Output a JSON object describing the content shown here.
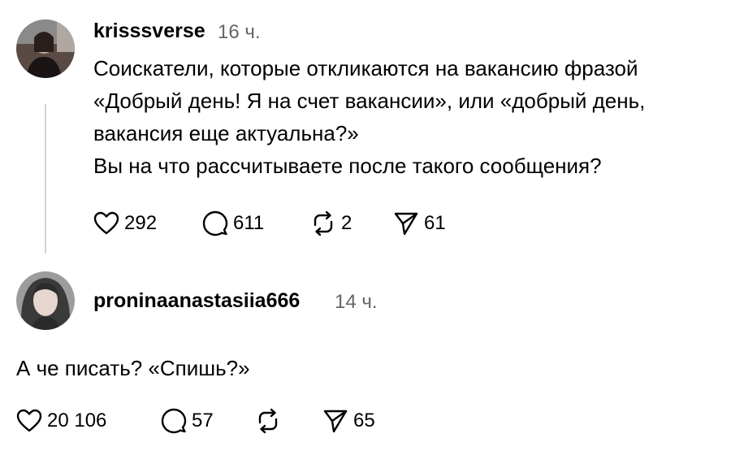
{
  "post": {
    "username": "krisssverse",
    "time": "16 ч.",
    "lines": [
      "Соискатели, которые откликаются на вакансию фразой",
      "«Добрый день! Я на счет вакансии», или «добрый день,",
      "вакансия еще актуальна?»",
      "Вы на что рассчитываете после такого сообщения?"
    ],
    "likes": "292",
    "comments": "611",
    "reposts": "2",
    "shares": "61"
  },
  "reply": {
    "username": "proninaanastasiia666",
    "time": "14 ч.",
    "text": "А че писать? «Спишь?»",
    "likes": "20 106",
    "comments": "57",
    "shares": "65"
  },
  "icons": {
    "like": "heart-icon",
    "comment": "comment-bubble-icon",
    "repost": "repost-icon",
    "share": "share-send-icon"
  },
  "colors": {
    "text": "#000000",
    "secondary_text": "#666666",
    "thread_line": "#d2d2d2",
    "background": "#ffffff"
  }
}
